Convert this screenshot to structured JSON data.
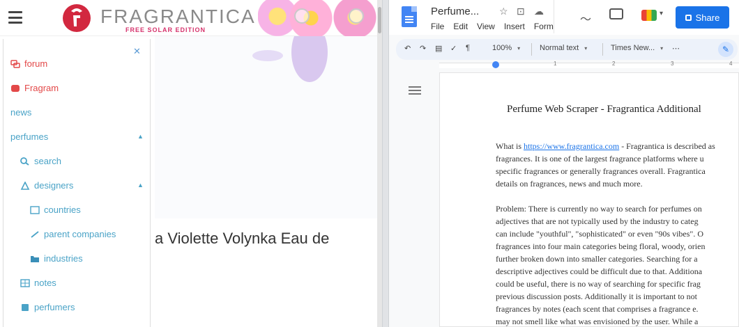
{
  "left_window": {
    "brand": "FRAGRANTICA",
    "tagline": "FREE SOLAR EDITION",
    "sidebar": {
      "items": [
        {
          "label": "forum"
        },
        {
          "label": "Fragram"
        },
        {
          "label": "news"
        },
        {
          "label": "perfumes"
        },
        {
          "label": "search"
        },
        {
          "label": "designers"
        },
        {
          "label": "countries"
        },
        {
          "label": "parent companies"
        },
        {
          "label": "industries"
        },
        {
          "label": "notes"
        },
        {
          "label": "perfumers"
        }
      ]
    },
    "product_title": "a Violette Volynka Eau de"
  },
  "right_window": {
    "doc_title": "Perfume...",
    "menu": [
      "File",
      "Edit",
      "View",
      "Insert",
      "Form"
    ],
    "share_label": "Share",
    "toolbar": {
      "zoom": "100%",
      "style": "Normal text",
      "font": "Times New..."
    },
    "ruler_numbers": [
      "1",
      "2",
      "3",
      "4"
    ],
    "document": {
      "heading": "Perfume Web Scraper - Fragrantica Additional",
      "p1_prefix": "What is ",
      "p1_link": "https://www.fragrantica.com",
      "p1_rest": "  - Fragrantica is described as\nfragrances. It is one of the largest fragrance platforms where u\nspecific fragrances or generally fragrances overall. Fragrantica\ndetails on fragrances, news and much more.",
      "p2": "Problem: There is currently no way to search for perfumes on\nadjectives that are not typically used by the industry to categ\ncan include \"youthful\", \"sophisticated\" or even \"90s vibes\". O\nfragrances into four main categories being floral, woody, orien\nfurther broken down into smaller categories. Searching for a\ndescriptive adjectives could be difficult due to that. Additiona\ncould be useful, there is no way of searching for specific frag\nprevious discussion posts. Additionally it is important to not\nfragrances by notes (each scent that comprises a fragrance e.\nmay not smell like what was envisioned by the user. While a"
    }
  }
}
